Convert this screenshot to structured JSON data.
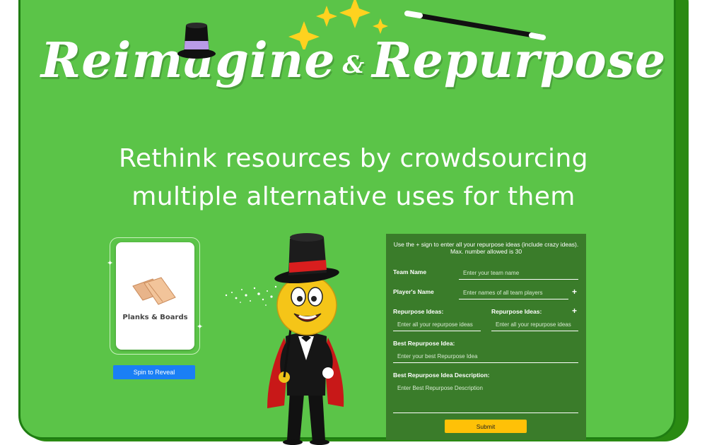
{
  "header": {
    "title_part1": "Reimagine",
    "title_amp": "&",
    "title_part2": "Repurpose",
    "subtitle_line1": "Rethink resources by crowdsourcing",
    "subtitle_line2": "multiple alternative uses for them"
  },
  "spinner": {
    "item_label": "Planks & Boards",
    "spin_button": "Spin to Reveal"
  },
  "form": {
    "instructions": "Use the + sign to enter all your repurpose ideas (include crazy ideas). Max. number allowed is 30",
    "team_name_label": "Team Name",
    "team_name_placeholder": "Enter your team name",
    "players_label": "Player's Name",
    "players_placeholder": "Enter names of all team players",
    "ideas_label_1": "Repurpose Ideas:",
    "ideas_label_2": "Repurpose Ideas:",
    "ideas_placeholder_1": "Enter all your repurpose ideas",
    "ideas_placeholder_2": "Enter all your repurpose ideas",
    "best_idea_label": "Best Repurpose Idea:",
    "best_idea_placeholder": "Enter your best Repurpose Idea",
    "description_label": "Best Repurpose Idea Description:",
    "description_placeholder": "Enter Best Repurpose Description",
    "plus_symbol": "+",
    "submit_label": "Submit"
  },
  "colors": {
    "background_green": "#5bc448",
    "border_green": "#1f7d12",
    "form_green": "#3a7c2a",
    "spin_button_blue": "#1a7ff5",
    "submit_yellow": "#ffc107"
  },
  "icons": [
    "top-hat-icon",
    "sparkle-stars-icon",
    "magic-wand-icon",
    "planks-icon",
    "magician-mascot-icon",
    "magic-dust-icon"
  ]
}
